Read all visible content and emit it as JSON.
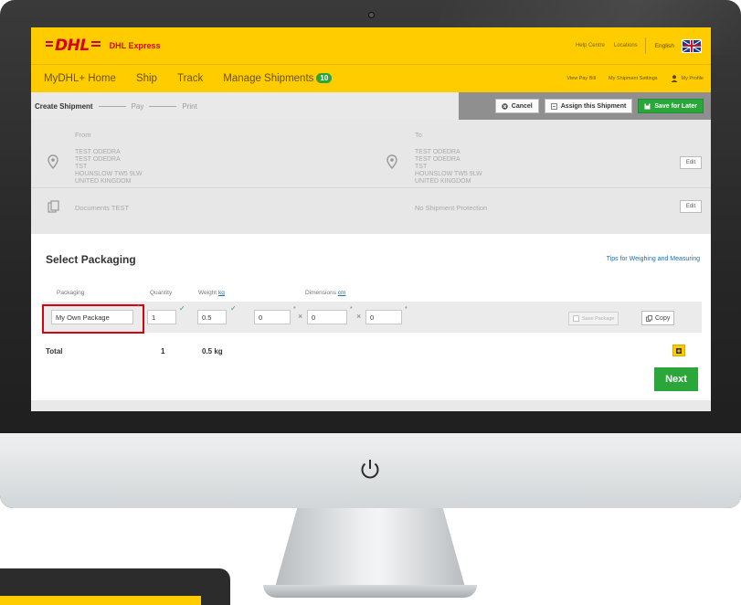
{
  "header": {
    "logo": "DHL",
    "brand": "DHL Express",
    "help_centre": "Help Centre",
    "locations": "Locations",
    "language": "English"
  },
  "nav": {
    "items": [
      "MyDHL+ Home",
      "Ship",
      "Track",
      "Manage Shipments"
    ],
    "manage_badge": "10",
    "view_pay_bill": "View Pay Bill",
    "shipment_settings": "My Shipment Settings",
    "profile": "My Profile"
  },
  "steps": {
    "create": "Create Shipment",
    "pay": "Pay",
    "print": "Print"
  },
  "actions": {
    "cancel": "Cancel",
    "assign": "Assign this Shipment",
    "save_later": "Save for Later"
  },
  "from": {
    "label": "From",
    "lines": [
      "TEST ODEDRA",
      "TEST ODEDRA",
      "TST",
      "HOUNSLOW TW5 9LW",
      "UNITED KINGDOM"
    ]
  },
  "to": {
    "label": "To",
    "lines": [
      "TEST ODEDRA",
      "TEST ODEDRA",
      "TST",
      "HOUNSLOW TW5 9LW",
      "UNITED KINGDOM"
    ]
  },
  "edit_label": "Edit",
  "documents": "Documents TEST",
  "protection": "No Shipment Protection",
  "packaging": {
    "title": "Select Packaging",
    "tips": "Tips for Weighing and Measuring",
    "headers": {
      "packaging": "Packaging",
      "quantity": "Quantity",
      "weight": "Weight",
      "weight_unit": "kg",
      "dimensions": "Dimensions",
      "dimensions_unit": "cm"
    },
    "row": {
      "package": "My Own Package",
      "quantity": "1",
      "weight": "0.5",
      "dim_l": "0",
      "dim_w": "0",
      "dim_h": "0",
      "save_package": "Save Package",
      "copy": "Copy"
    },
    "total": {
      "label": "Total",
      "quantity": "1",
      "weight": "0.5 kg"
    },
    "next": "Next"
  },
  "colors": {
    "dhl_yellow": "#ffcc00",
    "dhl_red": "#d40511",
    "green": "#2aa63a"
  }
}
